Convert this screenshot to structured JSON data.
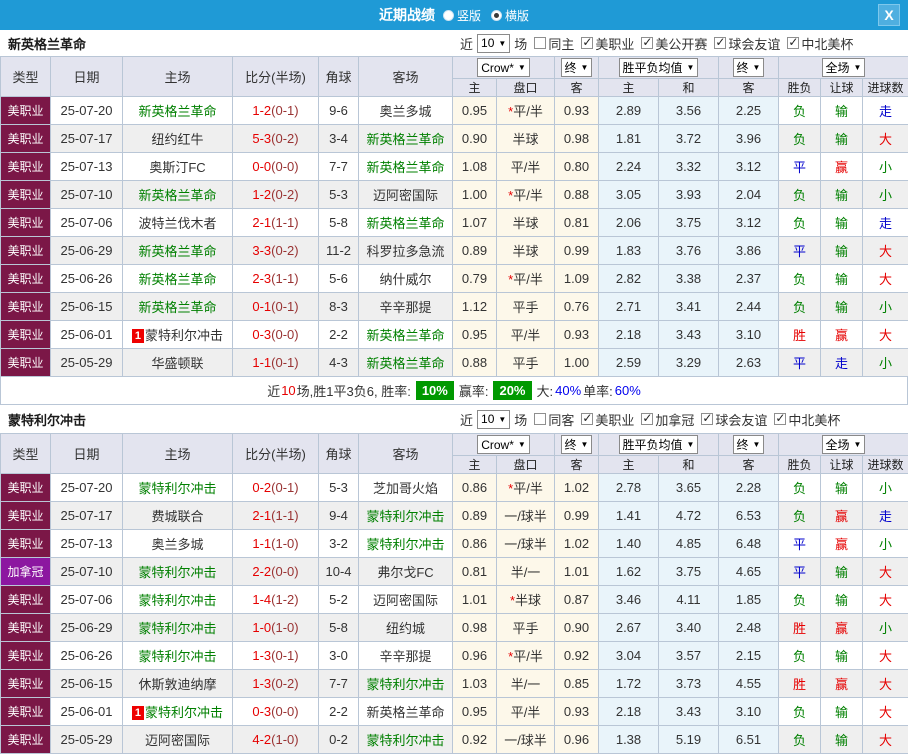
{
  "titlebar": {
    "title": "近期战绩",
    "options": [
      {
        "label": "竖版",
        "selected": false
      },
      {
        "label": "横版",
        "selected": true
      }
    ],
    "close_icon": "X"
  },
  "colors": {
    "titlebar_bg": "#1f9ad6",
    "header_bg": "#e3e4ef",
    "focus_team": "#008000",
    "score_full": "#e60000",
    "score_half": "#993333",
    "alt_row": "#efefef",
    "odds_bg": "#fdf8ea",
    "avg_bg": "#e9f4fa",
    "badge_bg": "#009900",
    "percent_text": "#0000ee",
    "league_colors": {
      "美职业": "#7b1747",
      "加拿冠": "#8c17a0"
    },
    "outcome_colors": {
      "胜": "#e60000",
      "赢": "#e60000",
      "大": "#e60000",
      "负": "#008000",
      "输": "#008000",
      "小": "#008000",
      "平": "#0000cc",
      "走": "#0000cc"
    }
  },
  "table": {
    "columns": [
      "类型",
      "日期",
      "主场",
      "比分(半场)",
      "角球",
      "客场",
      "主",
      "盘口",
      "客",
      "主",
      "和",
      "客",
      "胜负",
      "让球",
      "进球数"
    ],
    "dropdowns": [
      {
        "label": "Crow*",
        "span": 2,
        "name": "bookmaker-select"
      },
      {
        "label": "终",
        "span": 1,
        "name": "odds-stage-select"
      },
      {
        "label": "胜平负均值",
        "span": 2,
        "name": "avg-type-select"
      },
      {
        "label": "终",
        "span": 1,
        "name": "avg-stage-select"
      },
      {
        "label": "全场",
        "span": 3,
        "name": "scope-select"
      }
    ]
  },
  "sections": [
    {
      "team": "新英格兰革命",
      "filter": {
        "near_label": "近",
        "count": "10",
        "games_label": "场",
        "same_label": "同主",
        "same_checked": false,
        "leagues": [
          {
            "label": "美职业",
            "checked": true
          },
          {
            "label": "美公开赛",
            "checked": true
          },
          {
            "label": "球会友谊",
            "checked": true
          },
          {
            "label": "中北美杯",
            "checked": true
          }
        ]
      },
      "rows": [
        {
          "league": "美职业",
          "date": "25-07-20",
          "home": "新英格兰革命",
          "home_focus": true,
          "home_badge": null,
          "score": "1-2",
          "half": "(0-1)",
          "corners": "9-6",
          "away": "奥兰多城",
          "away_focus": false,
          "away_badge": null,
          "odds": [
            "0.95",
            "*平/半",
            "0.93"
          ],
          "avgs": [
            "2.89",
            "3.56",
            "2.25"
          ],
          "outcome": [
            "负",
            "输",
            "走"
          ]
        },
        {
          "league": "美职业",
          "date": "25-07-17",
          "home": "纽约红牛",
          "home_focus": false,
          "home_badge": null,
          "score": "5-3",
          "half": "(0-2)",
          "corners": "3-4",
          "away": "新英格兰革命",
          "away_focus": true,
          "away_badge": null,
          "odds": [
            "0.90",
            "半球",
            "0.98"
          ],
          "avgs": [
            "1.81",
            "3.72",
            "3.96"
          ],
          "outcome": [
            "负",
            "输",
            "大"
          ]
        },
        {
          "league": "美职业",
          "date": "25-07-13",
          "home": "奥斯汀FC",
          "home_focus": false,
          "home_badge": null,
          "score": "0-0",
          "half": "(0-0)",
          "corners": "7-7",
          "away": "新英格兰革命",
          "away_focus": true,
          "away_badge": null,
          "odds": [
            "1.08",
            "平/半",
            "0.80"
          ],
          "avgs": [
            "2.24",
            "3.32",
            "3.12"
          ],
          "outcome": [
            "平",
            "赢",
            "小"
          ]
        },
        {
          "league": "美职业",
          "date": "25-07-10",
          "home": "新英格兰革命",
          "home_focus": true,
          "home_badge": null,
          "score": "1-2",
          "half": "(0-2)",
          "corners": "5-3",
          "away": "迈阿密国际",
          "away_focus": false,
          "away_badge": null,
          "odds": [
            "1.00",
            "*平/半",
            "0.88"
          ],
          "avgs": [
            "3.05",
            "3.93",
            "2.04"
          ],
          "outcome": [
            "负",
            "输",
            "小"
          ]
        },
        {
          "league": "美职业",
          "date": "25-07-06",
          "home": "波特兰伐木者",
          "home_focus": false,
          "home_badge": null,
          "score": "2-1",
          "half": "(1-1)",
          "corners": "5-8",
          "away": "新英格兰革命",
          "away_focus": true,
          "away_badge": null,
          "odds": [
            "1.07",
            "半球",
            "0.81"
          ],
          "avgs": [
            "2.06",
            "3.75",
            "3.12"
          ],
          "outcome": [
            "负",
            "输",
            "走"
          ]
        },
        {
          "league": "美职业",
          "date": "25-06-29",
          "home": "新英格兰革命",
          "home_focus": true,
          "home_badge": null,
          "score": "3-3",
          "half": "(0-2)",
          "corners": "11-2",
          "away": "科罗拉多急流",
          "away_focus": false,
          "away_badge": null,
          "odds": [
            "0.89",
            "半球",
            "0.99"
          ],
          "avgs": [
            "1.83",
            "3.76",
            "3.86"
          ],
          "outcome": [
            "平",
            "输",
            "大"
          ]
        },
        {
          "league": "美职业",
          "date": "25-06-26",
          "home": "新英格兰革命",
          "home_focus": true,
          "home_badge": null,
          "score": "2-3",
          "half": "(1-1)",
          "corners": "5-6",
          "away": "纳什威尔",
          "away_focus": false,
          "away_badge": null,
          "odds": [
            "0.79",
            "*平/半",
            "1.09"
          ],
          "avgs": [
            "2.82",
            "3.38",
            "2.37"
          ],
          "outcome": [
            "负",
            "输",
            "大"
          ]
        },
        {
          "league": "美职业",
          "date": "25-06-15",
          "home": "新英格兰革命",
          "home_focus": true,
          "home_badge": null,
          "score": "0-1",
          "half": "(0-1)",
          "corners": "8-3",
          "away": "辛辛那提",
          "away_focus": false,
          "away_badge": null,
          "odds": [
            "1.12",
            "平手",
            "0.76"
          ],
          "avgs": [
            "2.71",
            "3.41",
            "2.44"
          ],
          "outcome": [
            "负",
            "输",
            "小"
          ]
        },
        {
          "league": "美职业",
          "date": "25-06-01",
          "home": "蒙特利尔冲击",
          "home_focus": false,
          "home_badge": "1",
          "score": "0-3",
          "half": "(0-0)",
          "corners": "2-2",
          "away": "新英格兰革命",
          "away_focus": true,
          "away_badge": null,
          "odds": [
            "0.95",
            "平/半",
            "0.93"
          ],
          "avgs": [
            "2.18",
            "3.43",
            "3.10"
          ],
          "outcome": [
            "胜",
            "赢",
            "大"
          ]
        },
        {
          "league": "美职业",
          "date": "25-05-29",
          "home": "华盛顿联",
          "home_focus": false,
          "home_badge": null,
          "score": "1-1",
          "half": "(0-1)",
          "corners": "4-3",
          "away": "新英格兰革命",
          "away_focus": true,
          "away_badge": null,
          "odds": [
            "0.88",
            "平手",
            "1.00"
          ],
          "avgs": [
            "2.59",
            "3.29",
            "2.63"
          ],
          "outcome": [
            "平",
            "走",
            "小"
          ]
        }
      ],
      "summary": [
        {
          "text": "近",
          "style": "plain"
        },
        {
          "text": "10",
          "style": "red"
        },
        {
          "text": "场,胜1平3负6, 胜率:",
          "style": "plain"
        },
        {
          "text": "10%",
          "style": "badge"
        },
        {
          "text": "赢率:",
          "style": "plain"
        },
        {
          "text": "20%",
          "style": "badge"
        },
        {
          "text": "大:",
          "style": "plain"
        },
        {
          "text": "40%",
          "style": "percent"
        },
        {
          "text": "单率:",
          "style": "plain"
        },
        {
          "text": "60%",
          "style": "percent"
        }
      ]
    },
    {
      "team": "蒙特利尔冲击",
      "filter": {
        "near_label": "近",
        "count": "10",
        "games_label": "场",
        "same_label": "同客",
        "same_checked": false,
        "leagues": [
          {
            "label": "美职业",
            "checked": true
          },
          {
            "label": "加拿冠",
            "checked": true
          },
          {
            "label": "球会友谊",
            "checked": true
          },
          {
            "label": "中北美杯",
            "checked": true
          }
        ]
      },
      "rows": [
        {
          "league": "美职业",
          "date": "25-07-20",
          "home": "蒙特利尔冲击",
          "home_focus": true,
          "home_badge": null,
          "score": "0-2",
          "half": "(0-1)",
          "corners": "5-3",
          "away": "芝加哥火焰",
          "away_focus": false,
          "away_badge": null,
          "odds": [
            "0.86",
            "*平/半",
            "1.02"
          ],
          "avgs": [
            "2.78",
            "3.65",
            "2.28"
          ],
          "outcome": [
            "负",
            "输",
            "小"
          ]
        },
        {
          "league": "美职业",
          "date": "25-07-17",
          "home": "费城联合",
          "home_focus": false,
          "home_badge": null,
          "score": "2-1",
          "half": "(1-1)",
          "corners": "9-4",
          "away": "蒙特利尔冲击",
          "away_focus": true,
          "away_badge": null,
          "odds": [
            "0.89",
            "一/球半",
            "0.99"
          ],
          "avgs": [
            "1.41",
            "4.72",
            "6.53"
          ],
          "outcome": [
            "负",
            "赢",
            "走"
          ]
        },
        {
          "league": "美职业",
          "date": "25-07-13",
          "home": "奥兰多城",
          "home_focus": false,
          "home_badge": null,
          "score": "1-1",
          "half": "(1-0)",
          "corners": "3-2",
          "away": "蒙特利尔冲击",
          "away_focus": true,
          "away_badge": null,
          "odds": [
            "0.86",
            "一/球半",
            "1.02"
          ],
          "avgs": [
            "1.40",
            "4.85",
            "6.48"
          ],
          "outcome": [
            "平",
            "赢",
            "小"
          ]
        },
        {
          "league": "加拿冠",
          "date": "25-07-10",
          "home": "蒙特利尔冲击",
          "home_focus": true,
          "home_badge": null,
          "score": "2-2",
          "half": "(0-0)",
          "corners": "10-4",
          "away": "弗尔戈FC",
          "away_focus": false,
          "away_badge": null,
          "odds": [
            "0.81",
            "半/一",
            "1.01"
          ],
          "avgs": [
            "1.62",
            "3.75",
            "4.65"
          ],
          "outcome": [
            "平",
            "输",
            "大"
          ]
        },
        {
          "league": "美职业",
          "date": "25-07-06",
          "home": "蒙特利尔冲击",
          "home_focus": true,
          "home_badge": null,
          "score": "1-4",
          "half": "(1-2)",
          "corners": "5-2",
          "away": "迈阿密国际",
          "away_focus": false,
          "away_badge": null,
          "odds": [
            "1.01",
            "*半球",
            "0.87"
          ],
          "avgs": [
            "3.46",
            "4.11",
            "1.85"
          ],
          "outcome": [
            "负",
            "输",
            "大"
          ]
        },
        {
          "league": "美职业",
          "date": "25-06-29",
          "home": "蒙特利尔冲击",
          "home_focus": true,
          "home_badge": null,
          "score": "1-0",
          "half": "(1-0)",
          "corners": "5-8",
          "away": "纽约城",
          "away_focus": false,
          "away_badge": null,
          "odds": [
            "0.98",
            "平手",
            "0.90"
          ],
          "avgs": [
            "2.67",
            "3.40",
            "2.48"
          ],
          "outcome": [
            "胜",
            "赢",
            "小"
          ]
        },
        {
          "league": "美职业",
          "date": "25-06-26",
          "home": "蒙特利尔冲击",
          "home_focus": true,
          "home_badge": null,
          "score": "1-3",
          "half": "(0-1)",
          "corners": "3-0",
          "away": "辛辛那提",
          "away_focus": false,
          "away_badge": null,
          "odds": [
            "0.96",
            "*平/半",
            "0.92"
          ],
          "avgs": [
            "3.04",
            "3.57",
            "2.15"
          ],
          "outcome": [
            "负",
            "输",
            "大"
          ]
        },
        {
          "league": "美职业",
          "date": "25-06-15",
          "home": "休斯敦迪纳摩",
          "home_focus": false,
          "home_badge": null,
          "score": "1-3",
          "half": "(0-2)",
          "corners": "7-7",
          "away": "蒙特利尔冲击",
          "away_focus": true,
          "away_badge": null,
          "odds": [
            "1.03",
            "半/一",
            "0.85"
          ],
          "avgs": [
            "1.72",
            "3.73",
            "4.55"
          ],
          "outcome": [
            "胜",
            "赢",
            "大"
          ]
        },
        {
          "league": "美职业",
          "date": "25-06-01",
          "home": "蒙特利尔冲击",
          "home_focus": true,
          "home_badge": "1",
          "score": "0-3",
          "half": "(0-0)",
          "corners": "2-2",
          "away": "新英格兰革命",
          "away_focus": false,
          "away_badge": null,
          "odds": [
            "0.95",
            "平/半",
            "0.93"
          ],
          "avgs": [
            "2.18",
            "3.43",
            "3.10"
          ],
          "outcome": [
            "负",
            "输",
            "大"
          ]
        },
        {
          "league": "美职业",
          "date": "25-05-29",
          "home": "迈阿密国际",
          "home_focus": false,
          "home_badge": null,
          "score": "4-2",
          "half": "(1-0)",
          "corners": "0-2",
          "away": "蒙特利尔冲击",
          "away_focus": true,
          "away_badge": null,
          "odds": [
            "0.92",
            "一/球半",
            "0.96"
          ],
          "avgs": [
            "1.38",
            "5.19",
            "6.51"
          ],
          "outcome": [
            "负",
            "输",
            "大"
          ]
        }
      ],
      "summary": null
    }
  ]
}
